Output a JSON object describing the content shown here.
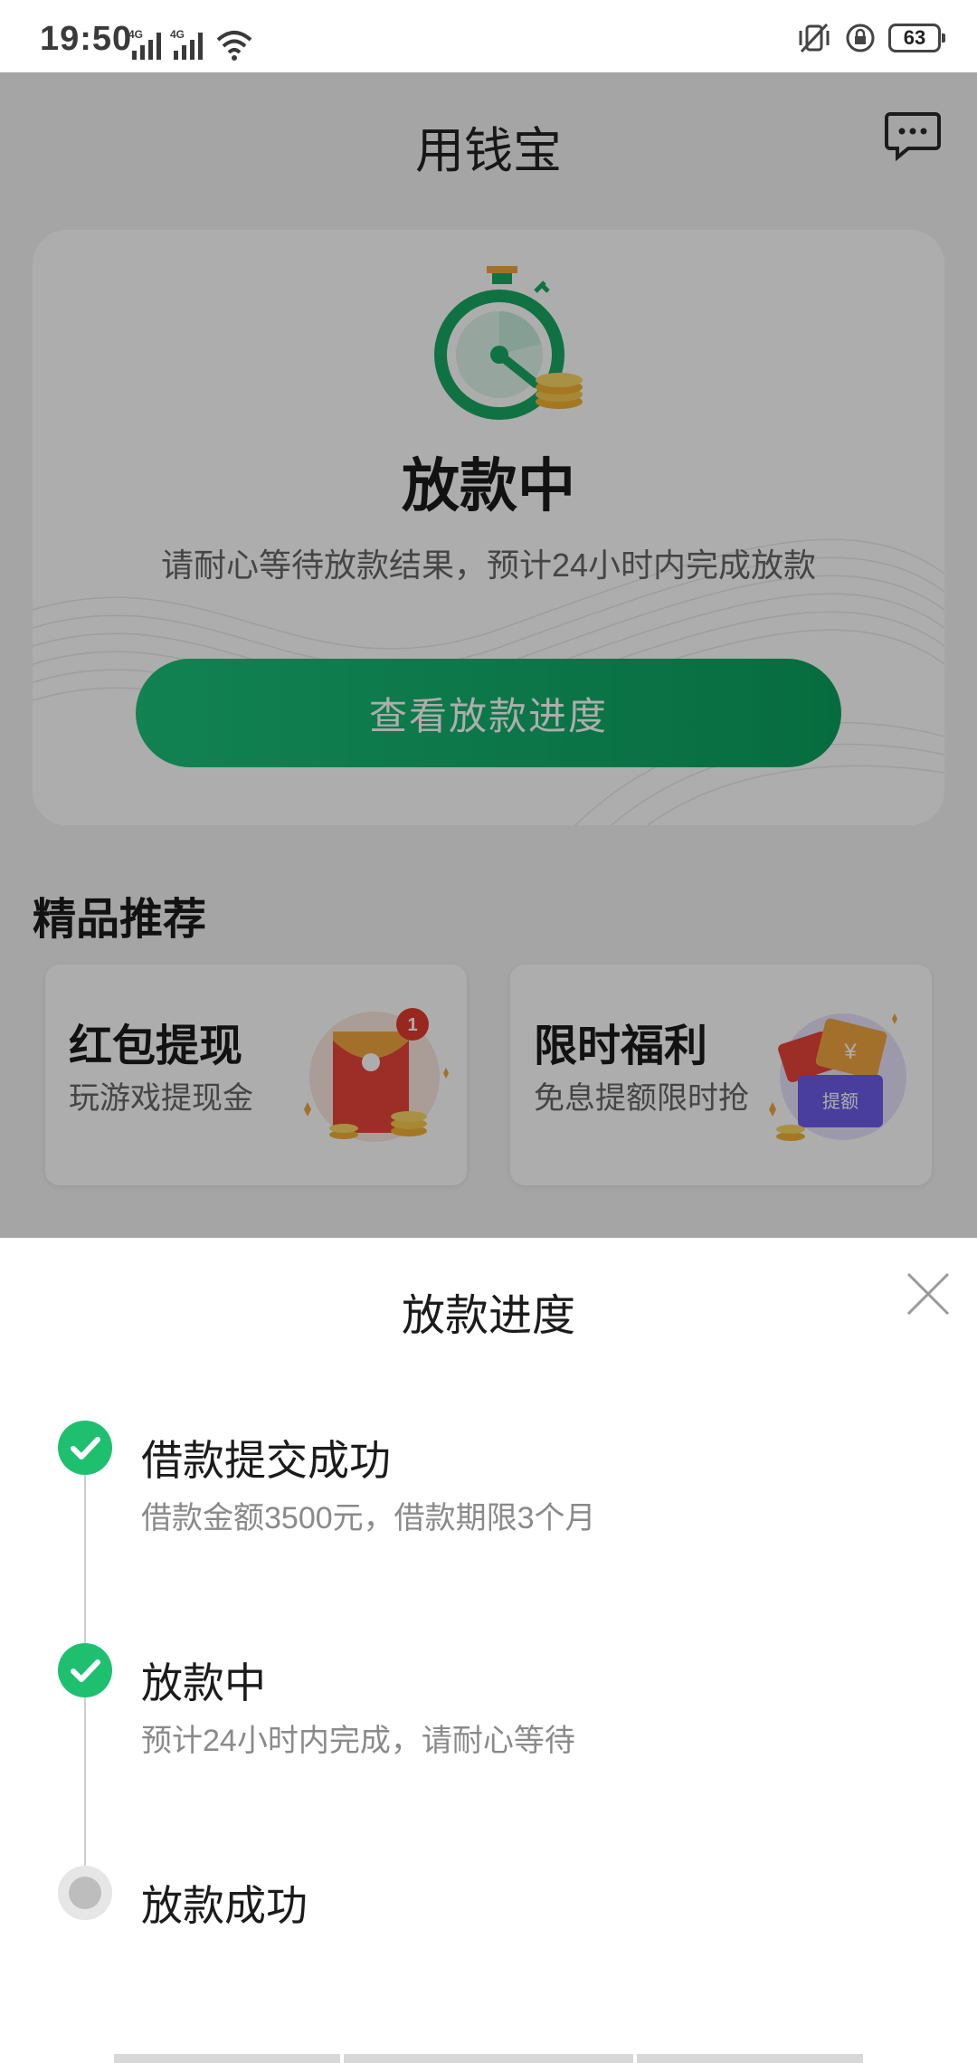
{
  "status_bar": {
    "time": "19:50",
    "network_1": "4G",
    "network_2": "4G",
    "battery": "63"
  },
  "header": {
    "title": "用钱宝",
    "message_icon": "chat-bubble-icon"
  },
  "hero": {
    "icon": "stopwatch-icon",
    "title": "放款中",
    "subtitle": "请耐心等待放款结果，预计24小时内完成放款",
    "button_label": "查看放款进度"
  },
  "recommend": {
    "section_title": "精品推荐",
    "cards": [
      {
        "title": "红包提现",
        "subtitle": "玩游戏提现金",
        "badge": "1",
        "icon": "red-envelope-icon"
      },
      {
        "title": "限时福利",
        "subtitle": "免息提额限时抢",
        "tag": "提额",
        "icon": "coupon-icon"
      }
    ]
  },
  "sheet": {
    "title": "放款进度",
    "close_icon": "close-icon",
    "steps": [
      {
        "title": "借款提交成功",
        "desc": "借款金额3500元，借款期限3个月",
        "status": "done"
      },
      {
        "title": "放款中",
        "desc": "预计24小时内完成，请耐心等待",
        "status": "done"
      },
      {
        "title": "放款成功",
        "desc": "",
        "status": "pending"
      }
    ]
  },
  "colors": {
    "accent_green": "#1ec070",
    "overlay": "rgba(0,0,0,0.32)"
  }
}
